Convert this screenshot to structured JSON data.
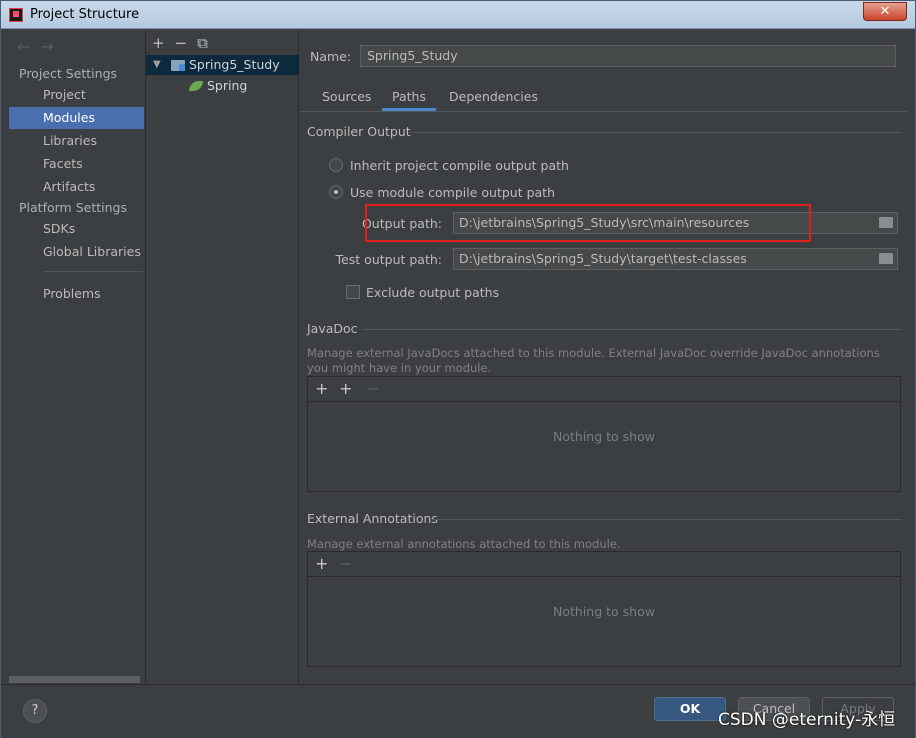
{
  "window": {
    "title": "Project Structure",
    "close_glyph": "✕"
  },
  "nav": {
    "back_icon": "←",
    "forward_icon": "→",
    "project_settings": "Project Settings",
    "items_project": [
      "Project",
      "Modules",
      "Libraries",
      "Facets",
      "Artifacts"
    ],
    "platform_settings": "Platform Settings",
    "items_platform": [
      "SDKs",
      "Global Libraries"
    ],
    "problems": "Problems",
    "selected": "Modules"
  },
  "tree": {
    "toolbar": {
      "add": "+",
      "remove": "−",
      "copy": "⧉"
    },
    "module": "Spring5_Study",
    "facet": "Spring"
  },
  "main": {
    "name_label": "Name:",
    "name_value": "Spring5_Study",
    "tabs": [
      "Sources",
      "Paths",
      "Dependencies"
    ],
    "active_tab": "Paths",
    "compiler_output": {
      "title": "Compiler Output",
      "inherit_label": "Inherit project compile output path",
      "use_module_label": "Use module compile output path",
      "selected_option": "use_module",
      "output_path_label": "Output path:",
      "output_path_value": "D:\\jetbrains\\Spring5_Study\\src\\main\\resources",
      "test_output_path_label": "Test output path:",
      "test_output_path_value": "D:\\jetbrains\\Spring5_Study\\target\\test-classes",
      "exclude_label": "Exclude output paths",
      "exclude_checked": false
    },
    "javadoc": {
      "title": "JavaDoc",
      "description": "Manage external JavaDocs attached to this module. External JavaDoc override JavaDoc annotations you might have in your module.",
      "add": "+",
      "add_url": "+",
      "remove": "−",
      "empty": "Nothing to show"
    },
    "external_annotations": {
      "title": "External Annotations",
      "description": "Manage external annotations attached to this module.",
      "add": "+",
      "remove": "−",
      "empty": "Nothing to show"
    }
  },
  "footer": {
    "help": "?",
    "ok": "OK",
    "cancel": "Cancel",
    "apply": "Apply"
  },
  "watermark": "CSDN @eternity-永恒",
  "colors": {
    "selection": "#4b6eaf",
    "highlight_box": "#e31c1c",
    "ok_button": "#365880"
  }
}
